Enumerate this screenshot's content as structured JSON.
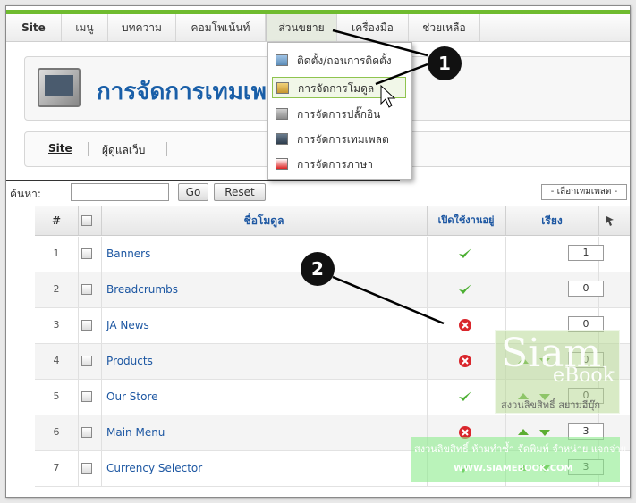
{
  "menu": {
    "items": [
      "Site",
      "เมนู",
      "บทความ",
      "คอมโพเน้นท์",
      "ส่วนขยาย",
      "เครื่องมือ",
      "ช่วยเหลือ"
    ]
  },
  "dropdown": {
    "items": [
      "ติดตั้ง/ถอนการติดตั้ง",
      "การจัดการโมดูล",
      "การจัดการปลั๊กอิน",
      "การจัดการเทมเพลต",
      "การจัดการภาษา"
    ]
  },
  "header": {
    "title": "การจัดการเทมเพลต"
  },
  "subnav": {
    "items": [
      "Site",
      "ผู้ดูแลเว็บ"
    ]
  },
  "filter": {
    "label": "ค้นหา:",
    "value": "",
    "go_label": "Go",
    "reset_label": "Reset",
    "template_select": "- เลือกเทมเพลต -"
  },
  "table": {
    "headers": [
      "#",
      "ชื่อโมดูล",
      "เปิดใช้งานอยู่",
      "เรียง"
    ],
    "rows": [
      {
        "num": "1",
        "name": "Banners",
        "enabled": true,
        "order": "1"
      },
      {
        "num": "2",
        "name": "Breadcrumbs",
        "enabled": true,
        "order": "0"
      },
      {
        "num": "3",
        "name": "JA News",
        "enabled": false,
        "order": "0"
      },
      {
        "num": "4",
        "name": "Products",
        "enabled": false,
        "order": "0"
      },
      {
        "num": "5",
        "name": "Our Store",
        "enabled": true,
        "order": "0"
      },
      {
        "num": "6",
        "name": "Main Menu",
        "enabled": false,
        "order": "3"
      },
      {
        "num": "7",
        "name": "Currency Selector",
        "enabled": true,
        "order": "3"
      }
    ]
  },
  "callouts": [
    "1",
    "2"
  ],
  "watermark": {
    "big": "Siam",
    "small": "eBook",
    "thai": "สงวนลิขสิทธิ์ สยามอีบุ๊ก"
  },
  "banner": {
    "line1": "สงวนลิขสิทธิ์ ห้ามทำซ้ำ จัดพิมพ์ จำหน่าย แจกจ่าย",
    "line2": "WWW.SIAMEBOOK.COM"
  },
  "colors": {
    "accent_green": "#6fbb2f",
    "link_blue": "#1d57a2",
    "title_blue": "#1a5fa8",
    "check_green": "#4caf32",
    "error_red": "#d9262c"
  }
}
